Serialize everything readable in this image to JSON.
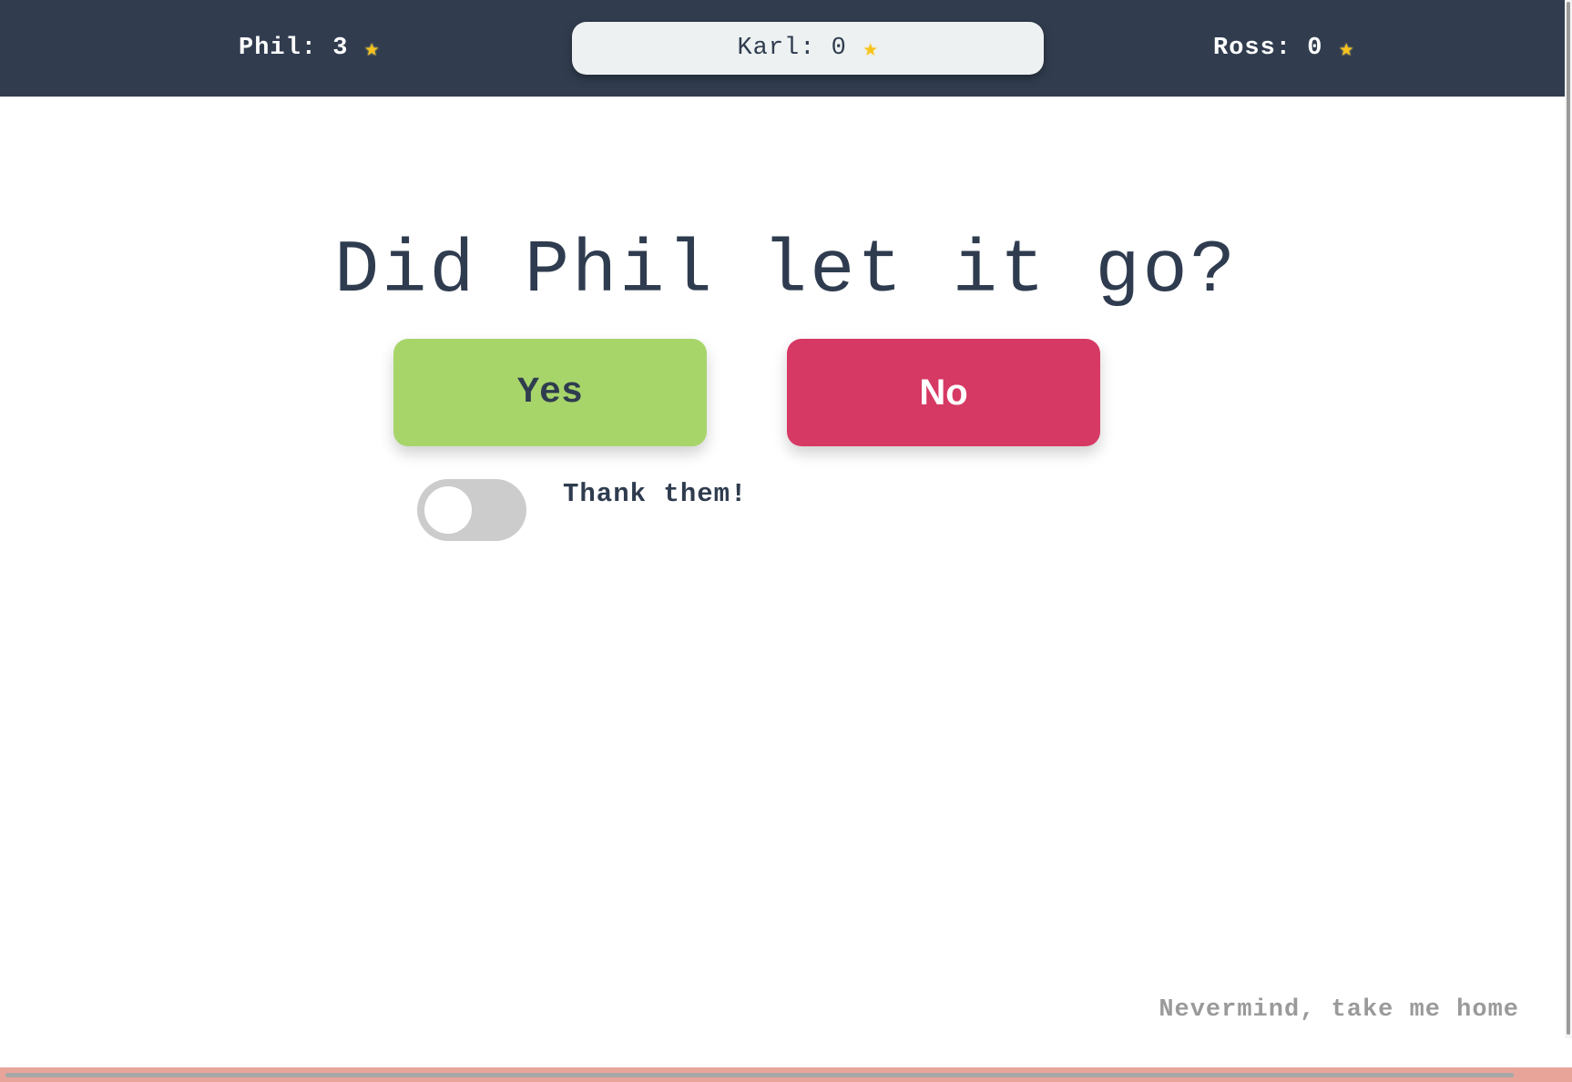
{
  "scorebar": {
    "players": [
      {
        "label": "Phil: 3",
        "icon": "star-icon",
        "glyph": "★"
      },
      {
        "label": "Karl: 0",
        "icon": "star-icon",
        "glyph": "★"
      },
      {
        "label": "Ross: 0",
        "icon": "star-icon",
        "glyph": "★"
      }
    ],
    "active_player": "Karl"
  },
  "question": {
    "text": "Did Phil let it go?"
  },
  "buttons": {
    "yes": "Yes",
    "no": "No"
  },
  "toggle": {
    "label": "Thank them!",
    "on": false
  },
  "footer": {
    "home_link": "Nevermind, take me home"
  },
  "colors": {
    "header_bg": "#313d4f",
    "yes": "#a8d56a",
    "no": "#d63964",
    "text": "#2f3c4f"
  }
}
